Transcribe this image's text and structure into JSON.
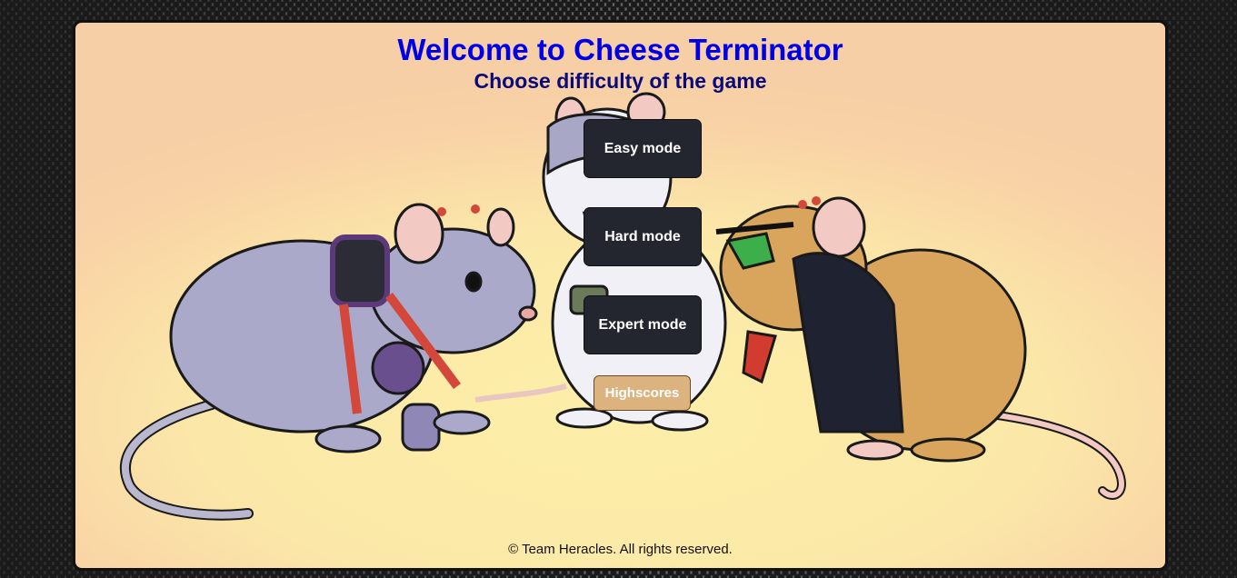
{
  "header": {
    "title": "Welcome to Cheese Terminator",
    "subtitle": "Choose difficulty of the game"
  },
  "menu": {
    "easy_label": "Easy mode",
    "hard_label": "Hard mode",
    "expert_label": "Expert mode",
    "highscores_label": "Highscores"
  },
  "footer": {
    "copyright": "© Team Heracles. All rights reserved."
  },
  "colors": {
    "title": "#0000e6",
    "subtitle": "#0a0a7a",
    "button_bg": "#23262f",
    "highscores_bg": "#dcb37f",
    "panel_edge": "#f7cfa6",
    "panel_center": "#fcefa9"
  },
  "illustration": {
    "subject": "four-rats-cyborg-gang"
  }
}
